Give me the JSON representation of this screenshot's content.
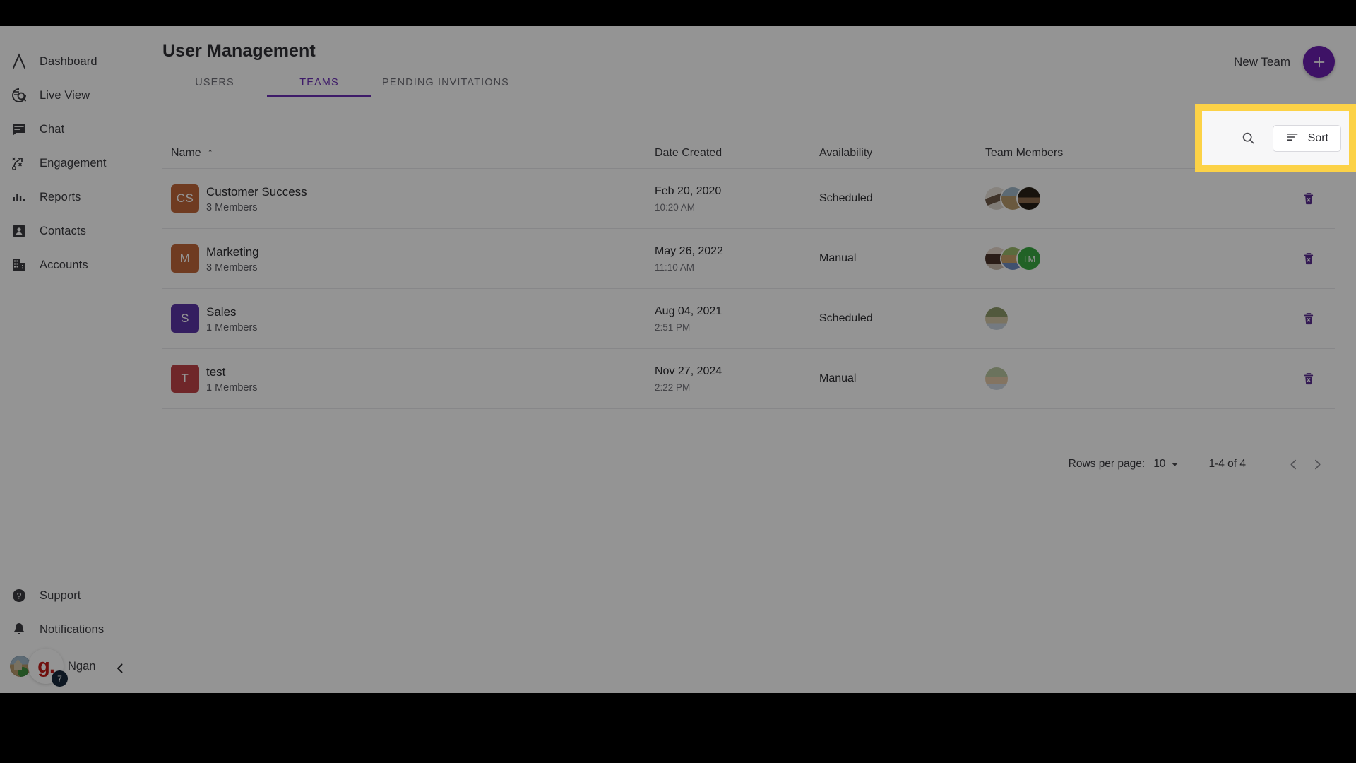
{
  "sidebar": {
    "items": [
      {
        "label": "Dashboard",
        "icon": "logo-lambda-icon"
      },
      {
        "label": "Live View",
        "icon": "live-view-icon"
      },
      {
        "label": "Chat",
        "icon": "chat-icon"
      },
      {
        "label": "Engagement",
        "icon": "engagement-icon"
      },
      {
        "label": "Reports",
        "icon": "reports-icon"
      },
      {
        "label": "Contacts",
        "icon": "contacts-icon"
      },
      {
        "label": "Accounts",
        "icon": "accounts-icon"
      }
    ],
    "bottom_items": [
      {
        "label": "Support",
        "icon": "help-icon"
      },
      {
        "label": "Notifications",
        "icon": "bell-icon"
      }
    ],
    "user": {
      "name": "Ngan",
      "brand_mark": "g.",
      "badge_count": "7"
    }
  },
  "header": {
    "title": "User Management",
    "tabs": [
      {
        "label": "USERS",
        "active": false
      },
      {
        "label": "TEAMS",
        "active": true
      },
      {
        "label": "PENDING INVITATIONS",
        "active": false
      }
    ],
    "new_team_label": "New Team",
    "add_icon": "plus-icon",
    "accent_color": "#6c2fb5"
  },
  "toolbar": {
    "search_icon": "search-icon",
    "sort_label": "Sort",
    "sort_icon": "sort-icon",
    "highlight_color": "#fcd247"
  },
  "table": {
    "columns": [
      "Name",
      "Date Created",
      "Availability",
      "Team Members"
    ],
    "sort_indicator": "↑",
    "rows": [
      {
        "initials": "CS",
        "avatar_color": "#c0673a",
        "name": "Customer Success",
        "members": "3 Members",
        "date": "Feb 20, 2020",
        "time": "10:20 AM",
        "availability": "Scheduled",
        "people": [
          {
            "type": "photo",
            "tone": "photo-a"
          },
          {
            "type": "photo",
            "tone": "photo-b"
          },
          {
            "type": "photo",
            "tone": "photo-c"
          }
        ],
        "delete_icon": "delete-icon"
      },
      {
        "initials": "M",
        "avatar_color": "#c0673a",
        "name": "Marketing",
        "members": "3 Members",
        "date": "May 26, 2022",
        "time": "11:10 AM",
        "availability": "Manual",
        "people": [
          {
            "type": "photo",
            "tone": "photo-d"
          },
          {
            "type": "photo",
            "tone": "photo-e"
          },
          {
            "type": "initials",
            "label": "TM",
            "color": "#3aaa42"
          }
        ],
        "delete_icon": "delete-icon"
      },
      {
        "initials": "S",
        "avatar_color": "#5b35a6",
        "name": "Sales",
        "members": "1 Members",
        "date": "Aug 04, 2021",
        "time": "2:51 PM",
        "availability": "Scheduled",
        "people": [
          {
            "type": "photo",
            "tone": "photo-f"
          }
        ],
        "delete_icon": "delete-icon"
      },
      {
        "initials": "T",
        "avatar_color": "#bf4347",
        "name": "test",
        "members": "1 Members",
        "date": "Nov 27, 2024",
        "time": "2:22 PM",
        "availability": "Manual",
        "people": [
          {
            "type": "photo",
            "tone": "photo-g"
          }
        ],
        "delete_icon": "delete-icon"
      }
    ]
  },
  "pagination": {
    "rows_per_page_label": "Rows per page:",
    "rows_per_page_value": "10",
    "range_label": "1-4 of 4",
    "prev_icon": "chevron-left-icon",
    "next_icon": "chevron-right-icon"
  }
}
